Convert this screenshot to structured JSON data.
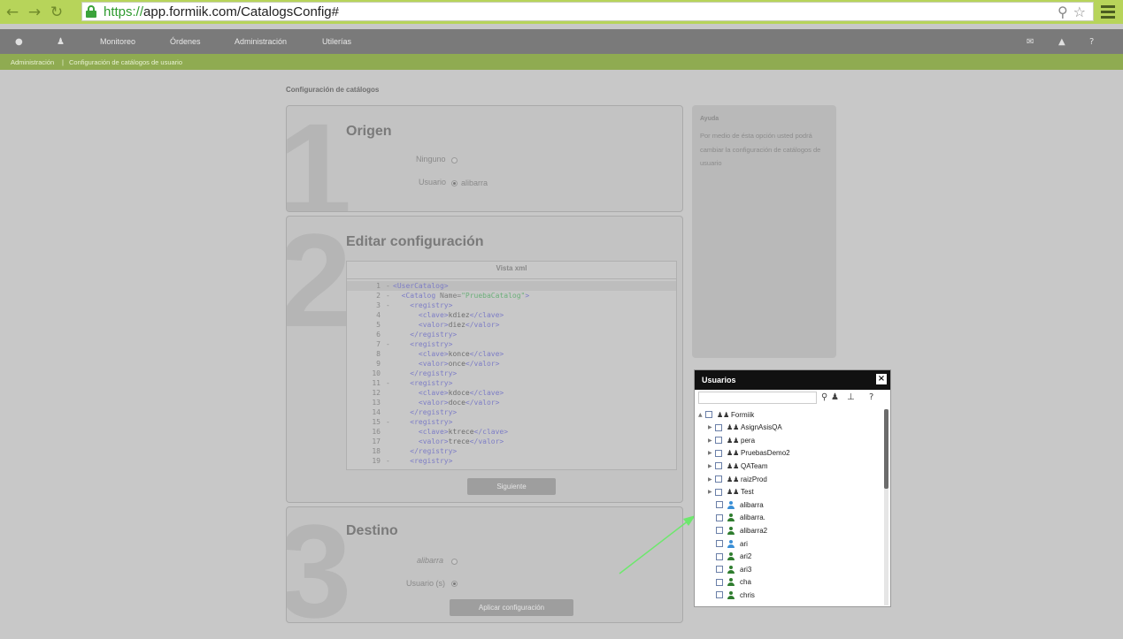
{
  "browser": {
    "url_protocol": "https://",
    "url_rest": "app.formiik.com/CatalogsConfig#"
  },
  "nav": {
    "items": [
      "Monitoreo",
      "Órdenes",
      "Administración",
      "Utilerías"
    ]
  },
  "breadcrumb": {
    "section": "Administración",
    "separator": "|",
    "page": "Configuración de catálogos de usuario"
  },
  "page": {
    "title": "Configuración de catálogos"
  },
  "step1": {
    "number": "1",
    "title": "Origen",
    "none_label": "Ninguno",
    "user_label": "Usuario",
    "user_value": "alibarra"
  },
  "step2": {
    "number": "2",
    "title": "Editar configuración",
    "editor_title": "Vista xml",
    "next_button": "Siguiente",
    "lines": [
      {
        "n": "1",
        "fold": "-",
        "indent": "",
        "tag_open": "<UserCatalog>",
        "attr": "",
        "str": "",
        "text": "",
        "tag_close": ""
      },
      {
        "n": "2",
        "fold": "-",
        "indent": "  ",
        "tag_open": "<Catalog ",
        "attr": "Name=",
        "str": "\"PruebaCatalog\"",
        "text": "",
        "tag_close": ">"
      },
      {
        "n": "3",
        "fold": "-",
        "indent": "    ",
        "tag_open": "<registry>",
        "attr": "",
        "str": "",
        "text": "",
        "tag_close": ""
      },
      {
        "n": "4",
        "fold": "",
        "indent": "      ",
        "tag_open": "<clave>",
        "attr": "",
        "str": "",
        "text": "kdiez",
        "tag_close": "</clave>"
      },
      {
        "n": "5",
        "fold": "",
        "indent": "      ",
        "tag_open": "<valor>",
        "attr": "",
        "str": "",
        "text": "diez",
        "tag_close": "</valor>"
      },
      {
        "n": "6",
        "fold": "",
        "indent": "    ",
        "tag_open": "</registry>",
        "attr": "",
        "str": "",
        "text": "",
        "tag_close": ""
      },
      {
        "n": "7",
        "fold": "-",
        "indent": "    ",
        "tag_open": "<registry>",
        "attr": "",
        "str": "",
        "text": "",
        "tag_close": ""
      },
      {
        "n": "8",
        "fold": "",
        "indent": "      ",
        "tag_open": "<clave>",
        "attr": "",
        "str": "",
        "text": "konce",
        "tag_close": "</clave>"
      },
      {
        "n": "9",
        "fold": "",
        "indent": "      ",
        "tag_open": "<valor>",
        "attr": "",
        "str": "",
        "text": "once",
        "tag_close": "</valor>"
      },
      {
        "n": "10",
        "fold": "",
        "indent": "    ",
        "tag_open": "</registry>",
        "attr": "",
        "str": "",
        "text": "",
        "tag_close": ""
      },
      {
        "n": "11",
        "fold": "-",
        "indent": "    ",
        "tag_open": "<registry>",
        "attr": "",
        "str": "",
        "text": "",
        "tag_close": ""
      },
      {
        "n": "12",
        "fold": "",
        "indent": "      ",
        "tag_open": "<clave>",
        "attr": "",
        "str": "",
        "text": "kdoce",
        "tag_close": "</clave>"
      },
      {
        "n": "13",
        "fold": "",
        "indent": "      ",
        "tag_open": "<valor>",
        "attr": "",
        "str": "",
        "text": "doce",
        "tag_close": "</valor>"
      },
      {
        "n": "14",
        "fold": "",
        "indent": "    ",
        "tag_open": "</registry>",
        "attr": "",
        "str": "",
        "text": "",
        "tag_close": ""
      },
      {
        "n": "15",
        "fold": "-",
        "indent": "    ",
        "tag_open": "<registry>",
        "attr": "",
        "str": "",
        "text": "",
        "tag_close": ""
      },
      {
        "n": "16",
        "fold": "",
        "indent": "      ",
        "tag_open": "<clave>",
        "attr": "",
        "str": "",
        "text": "ktrece",
        "tag_close": "</clave>"
      },
      {
        "n": "17",
        "fold": "",
        "indent": "      ",
        "tag_open": "<valor>",
        "attr": "",
        "str": "",
        "text": "trece",
        "tag_close": "</valor>"
      },
      {
        "n": "18",
        "fold": "",
        "indent": "    ",
        "tag_open": "</registry>",
        "attr": "",
        "str": "",
        "text": "",
        "tag_close": ""
      },
      {
        "n": "19",
        "fold": "-",
        "indent": "    ",
        "tag_open": "<registry>",
        "attr": "",
        "str": "",
        "text": "",
        "tag_close": ""
      }
    ]
  },
  "step3": {
    "number": "3",
    "title": "Destino",
    "selected_user_label": "alibarra",
    "users_label": "Usuario (s)",
    "apply_button": "Aplicar configuración"
  },
  "help": {
    "title": "Ayuda",
    "text": "Por medio de ésta opción usted podrá cambiar la configuración de catálogos de usuario"
  },
  "users_dialog": {
    "title": "Usuarios",
    "close_icon": "×",
    "root": "Formiik",
    "groups": [
      "AsignAsisQA",
      "pera",
      "PruebasDemo2",
      "QATeam",
      "raizProd",
      "Test"
    ],
    "users": [
      {
        "name": "alibarra",
        "color": "#3a8fd6"
      },
      {
        "name": "alibarra.",
        "color": "#2f7d2f"
      },
      {
        "name": "alibarra2",
        "color": "#2f7d2f"
      },
      {
        "name": "ari",
        "color": "#3a8fd6"
      },
      {
        "name": "ari2",
        "color": "#2f7d2f"
      },
      {
        "name": "ari3",
        "color": "#2f7d2f"
      },
      {
        "name": "cha",
        "color": "#2f7d2f"
      },
      {
        "name": "chris",
        "color": "#2f7d2f"
      }
    ]
  },
  "colors": {
    "browser_accent": "#b7d45a",
    "nav_bar": "#7a7a7a",
    "breadcrumb_bar": "#8fab51",
    "annotation_arrow": "#6de86d"
  }
}
